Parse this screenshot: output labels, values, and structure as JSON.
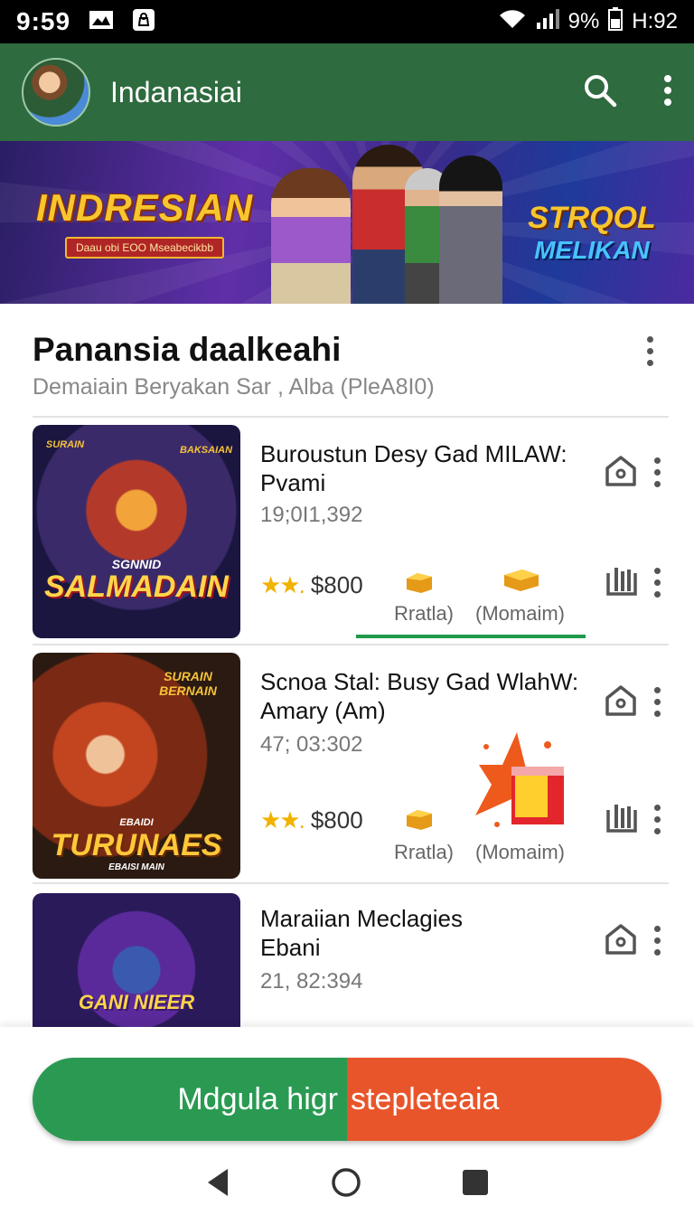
{
  "status_bar": {
    "time_left": "9:59",
    "battery_percent": "9%",
    "time_right": "H:92"
  },
  "app_bar": {
    "title": "Indanasiai"
  },
  "banner": {
    "left_logo": "INDRESIAN",
    "left_tagline": "Daau obi EOO Mseabecikbb",
    "right_logo_line1": "STRQOL",
    "right_logo_line2": "MELIKAN"
  },
  "section": {
    "title": "Panansia daalkeahi",
    "subtitle": "Demaiain Beryakan Sar , Alba (PleA8I0)"
  },
  "items": [
    {
      "thumb_title": "SALMADAIN",
      "thumb_badge": "SGNNID",
      "thumb_corner_left": "SURAIN",
      "thumb_corner_right": "BAKSAIAN",
      "title": "Buroustun Desy Gad MILAW: Pvami",
      "count": "19;0I1,392",
      "stars": "★★.",
      "price": "$800",
      "option_a": "Rratla)",
      "option_b": "(Momaim)"
    },
    {
      "thumb_title": "TURUNAES",
      "thumb_badge": "EBAIDI",
      "thumb_sub": "EBAISI MAIN",
      "thumb_corner_left": "SURAIN BERNAIN",
      "title": "Scnoa Stal: Busy Gad WlahW: Amary (Am)",
      "count": "47; 03:302",
      "stars": "★★.",
      "price": "$800",
      "option_a": "Rratla)",
      "option_b": "(Momaim)"
    },
    {
      "thumb_title": "GANI NIEER",
      "title": "Maraiian Meclagies Ebani",
      "count": "21, 82:394"
    }
  ],
  "cta": {
    "left_label": "Mdgula higr",
    "right_label": "stepleteaia"
  },
  "colors": {
    "app_bar": "#2e6b3f",
    "cta_green": "#2a9a52",
    "cta_orange": "#e8552a",
    "progress_underline": "#1f9a4a"
  }
}
